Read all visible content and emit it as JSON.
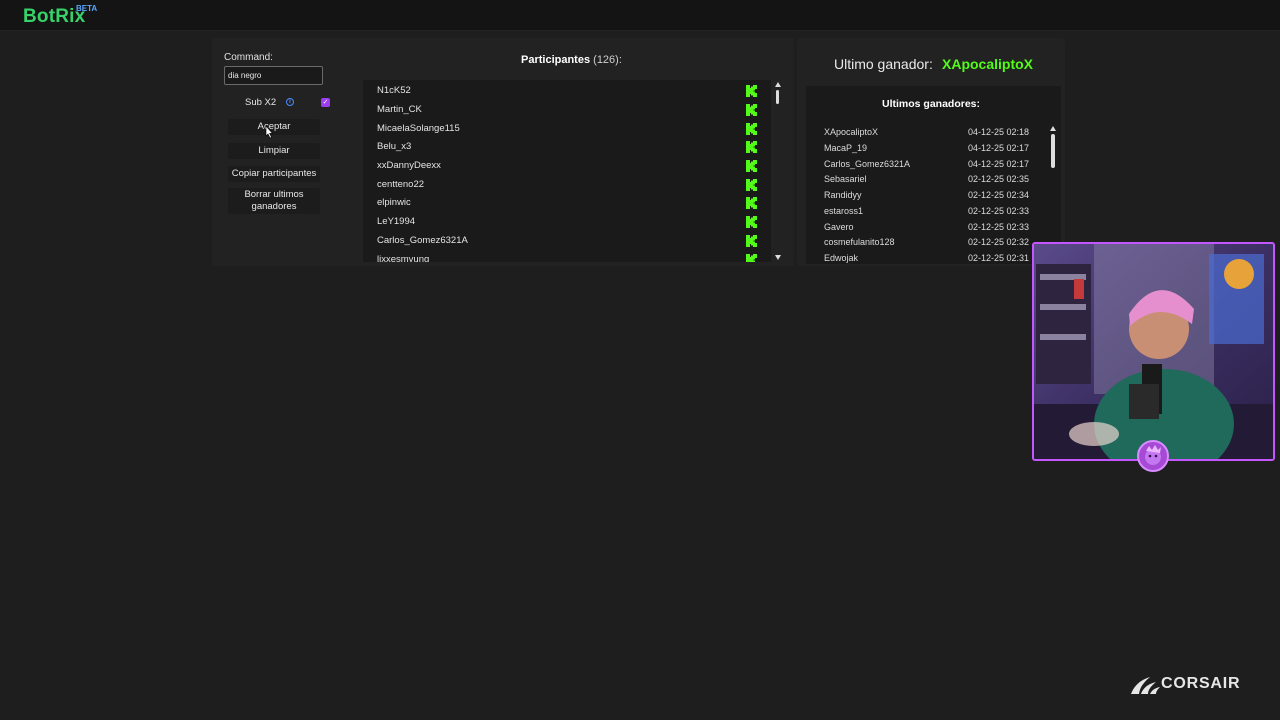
{
  "app": {
    "brand": "BotRix",
    "badge": "BETA",
    "brand_color": "#38d26a",
    "badge_color": "#5aa7ff"
  },
  "controls": {
    "command_label": "Command:",
    "command_value": "dia negro",
    "sub_label": "Sub X2",
    "sub_checked": true,
    "accept_label": "Aceptar",
    "clear_label": "Limpiar",
    "copy_label": "Copiar participantes",
    "delete_label": "Borrar ultimos ganadores"
  },
  "participants": {
    "title": "Participantes",
    "count": "(126):",
    "platform_icon": "kick-icon",
    "items": [
      "N1cK52",
      "Martin_CK",
      "MicaelaSolange115",
      "Belu_x3",
      "xxDannyDeexx",
      "centteno22",
      "elpinwic",
      "LeY1994",
      "Carlos_Gomez6321A",
      "lixxesmyung"
    ]
  },
  "last_winner": {
    "label": "Ultimo ganador:",
    "name": "XApocaliptoX",
    "accent": "#53fc18"
  },
  "winners": {
    "title": "Ultimos ganadores:",
    "items": [
      {
        "name": "XApocaliptoX",
        "date": "04-12-25 02:18"
      },
      {
        "name": "MacaP_19",
        "date": "04-12-25 02:17"
      },
      {
        "name": "Carlos_Gomez6321A",
        "date": "04-12-25 02:17"
      },
      {
        "name": "Sebasariel",
        "date": "02-12-25 02:35"
      },
      {
        "name": "Randidyy",
        "date": "02-12-25 02:34"
      },
      {
        "name": "estaross1",
        "date": "02-12-25 02:33"
      },
      {
        "name": "Gavero",
        "date": "02-12-25 02:33"
      },
      {
        "name": "cosmefulanito128",
        "date": "02-12-25 02:32"
      },
      {
        "name": "Edwojak",
        "date": "02-12-25 02:31"
      }
    ]
  },
  "overlay": {
    "sponsor": "CORSAIR",
    "frame_color": "#c456ff"
  }
}
